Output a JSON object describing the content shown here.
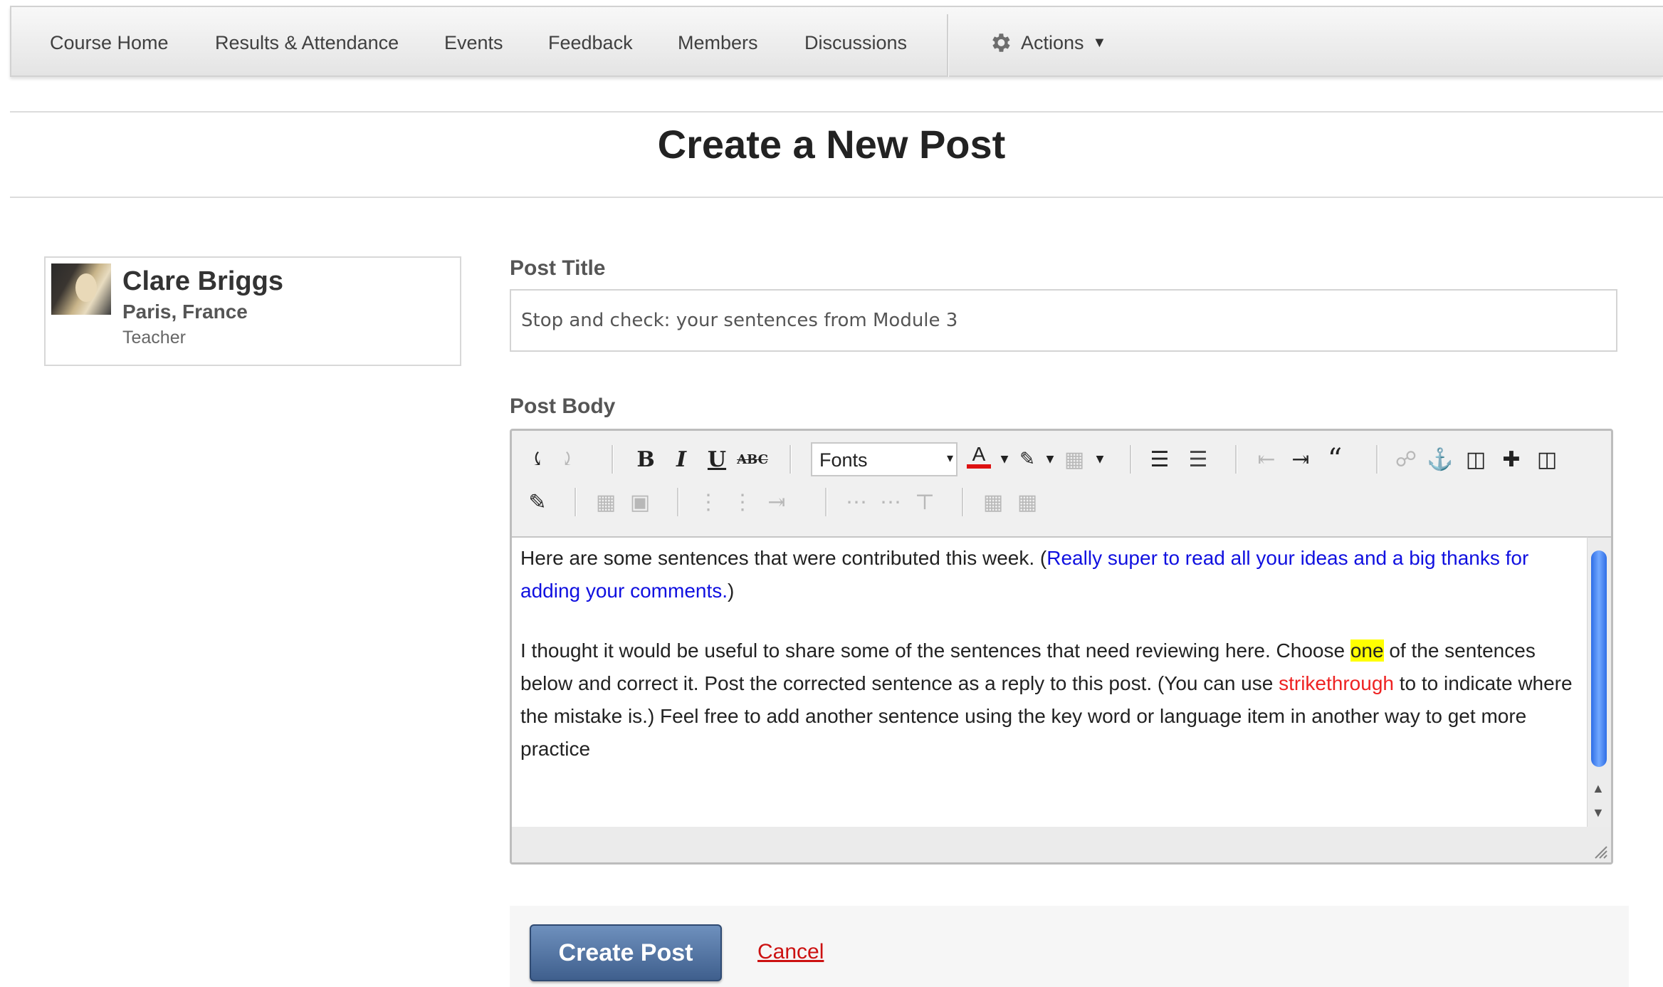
{
  "nav": {
    "items": [
      {
        "label": "Course Home"
      },
      {
        "label": "Results & Attendance"
      },
      {
        "label": "Events"
      },
      {
        "label": "Feedback"
      },
      {
        "label": "Members"
      },
      {
        "label": "Discussions"
      }
    ],
    "actions_label": "Actions",
    "actions_icon": "gear-icon"
  },
  "page": {
    "title": "Create a New Post"
  },
  "author": {
    "name": "Clare Briggs",
    "location": "Paris, France",
    "role": "Teacher"
  },
  "form": {
    "title_label": "Post Title",
    "title_value": "Stop and check: your sentences from Module 3",
    "body_label": "Post Body"
  },
  "editor": {
    "font_select_value": "Fonts",
    "font_color_swatch": "#dd1111",
    "toolbar_row1": [
      "undo-icon",
      "redo-icon",
      "bold-icon",
      "italic-icon",
      "underline-icon",
      "strikethrough-icon",
      "font-color-icon",
      "highlight-color-icon",
      "background-icon",
      "bulleted-list-icon",
      "numbered-list-icon",
      "outdent-icon",
      "indent-icon",
      "blockquote-icon",
      "unlink-icon",
      "anchor-icon",
      "insert-image-icon",
      "insert-media-icon",
      "insert-table-icon"
    ],
    "toolbar_row2": [
      "edit-source-icon",
      "table-cell-icon",
      "table-row-icon",
      "insert-row-before-icon",
      "insert-row-after-icon",
      "delete-row-icon",
      "insert-col-before-icon",
      "insert-col-after-icon",
      "delete-col-icon",
      "merge-cells-icon",
      "split-cells-icon"
    ],
    "body": {
      "p1_text": "Here are some sentences that were contributed this week. (",
      "p1_blue": "Really super to read all your ideas and a big thanks for adding your comments.",
      "p1_end": ")",
      "p2_a": "I thought it would be useful to share some of the sentences that need reviewing here. Choose ",
      "p2_highlight": "one",
      "p2_b": " of the sentences below and correct it. Post the corrected sentence as a reply to this post. (You can use ",
      "p2_red": "strikethrough",
      "p2_c": " to to indicate where the mistake is.) Feel free to add another sentence using the key word or language item in another way to get more practice"
    }
  },
  "buttons": {
    "create": "Create Post",
    "cancel": "Cancel"
  }
}
